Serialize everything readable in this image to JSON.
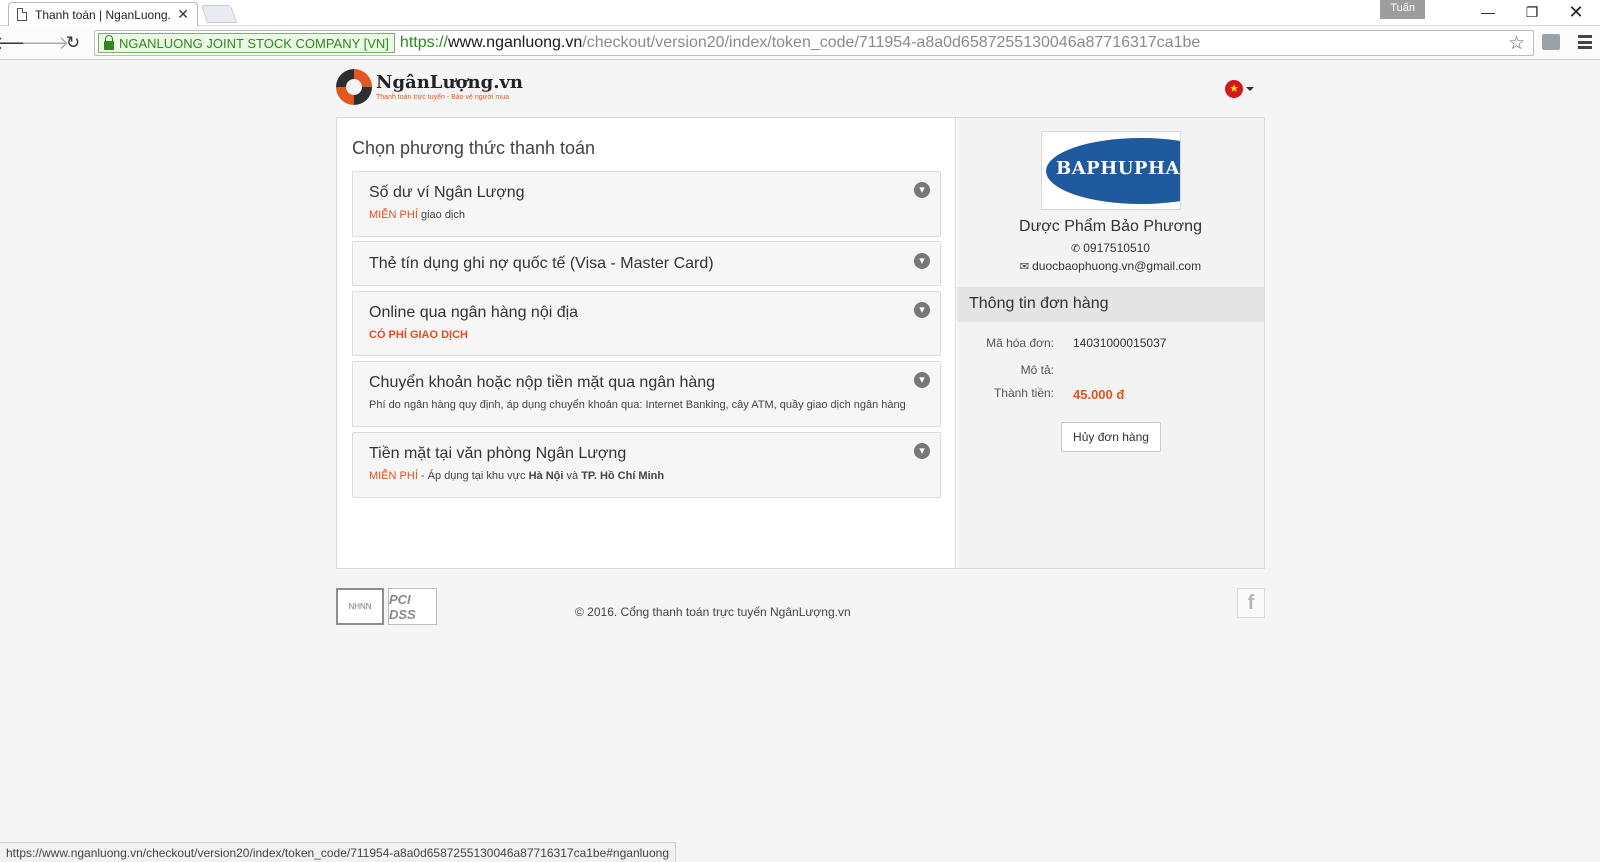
{
  "browser": {
    "tab_title": "Thanh toán | NganLuong.",
    "tab_close": "✕",
    "profile": "Tuấn",
    "win_min": "—",
    "win_max": "❐",
    "win_close": "✕",
    "ev_org": "NGANLUONG JOINT STOCK COMPANY [VN]",
    "url_proto": "https://",
    "url_host": "www.nganluong.vn",
    "url_path": "/checkout/version20/index/token_code/711954-a8a0d6587255130046a87716317ca1be",
    "status_url": "https://www.nganluong.vn/checkout/version20/index/token_code/711954-a8a0d6587255130046a87716317ca1be#nganluong"
  },
  "logo": {
    "name": "NgânLượng.vn",
    "tagline": "Thanh toán trực tuyến - Bảo vệ người mua"
  },
  "payment": {
    "section_title": "Chọn phương thức thanh toán",
    "methods": [
      {
        "title": "Số dư ví Ngân Lượng",
        "sub_highlight": "MIỄN PHÍ",
        "sub_rest": " giao dịch"
      },
      {
        "title": "Thẻ tín dụng ghi nợ quốc tế (Visa - Master Card)"
      },
      {
        "title": "Online qua ngân hàng nội địa",
        "sub_highlight": "CÓ PHÍ GIAO DỊCH"
      },
      {
        "title": "Chuyển khoản hoặc nộp tiền mặt qua ngân hàng",
        "sub_rest": "Phí do ngân hàng quy định, áp dụng chuyển khoản qua: Internet Banking, cây ATM, quầy giao dịch ngân hàng"
      },
      {
        "title": "Tiền mặt tại văn phòng Ngân Lượng",
        "sub_highlight": "MIỄN PHÍ",
        "sub_rest": " - Áp dụng tại khu vực ",
        "sub_bold1": "Hà Nội",
        "sub_mid": " và ",
        "sub_bold2": "TP. Hồ Chí Minh"
      }
    ]
  },
  "merchant": {
    "logo_text": "BAPHUPHA",
    "name": "Dược Phẩm Bảo Phương",
    "phone": "0917510510",
    "email": "duocbaophuong.vn@gmail.com"
  },
  "order": {
    "heading": "Thông tin đơn hàng",
    "invoice_label": "Mã hóa đơn:",
    "invoice_value": "14031000015037",
    "desc_label": "Mô tả:",
    "desc_value": "",
    "total_label": "Thành tiền:",
    "total_value": "45.000 đ",
    "cancel_label": "Hủy đơn hàng"
  },
  "footer": {
    "copyright": "© 2016. Cổng thanh toán trực tuyến NgânLượng.vn",
    "badge_nhnn": "NHNN",
    "badge_pci": "PCI DSS"
  },
  "colors": {
    "accent": "#e2571e",
    "ev_green": "#2b8a1e",
    "merchant_blue": "#1f5a9e"
  }
}
